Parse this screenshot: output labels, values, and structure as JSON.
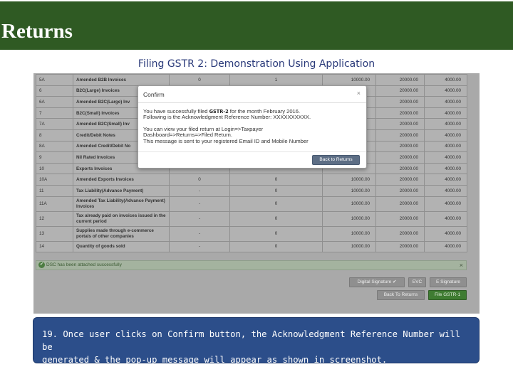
{
  "header": {
    "title": "Returns"
  },
  "subtitle": "Filing GSTR 2: Demonstration Using Application",
  "table": {
    "rows": [
      [
        "5A",
        "Amended B2B Invoices",
        "0",
        "1",
        "10000.00",
        "20000.00",
        "4000.00"
      ],
      [
        "6",
        "B2C(Large) Invoices",
        "",
        "",
        "",
        "20000.00",
        "4000.00"
      ],
      [
        "6A",
        "Amended B2C(Large) Inv",
        "",
        "",
        "",
        "20000.00",
        "4000.00"
      ],
      [
        "7",
        "B2C(Small) Invoices",
        "",
        "",
        "",
        "20000.00",
        "4000.00"
      ],
      [
        "7A",
        "Amended B2C(Small) Inv",
        "",
        "",
        "",
        "20000.00",
        "4000.00"
      ],
      [
        "8",
        "Credit/Debit Notes",
        "",
        "",
        "",
        "20000.00",
        "4000.00"
      ],
      [
        "8A",
        "Amended Credit/Debit No",
        "",
        "",
        "",
        "20000.00",
        "4000.00"
      ],
      [
        "9",
        "Nil Rated Invoices",
        "",
        "",
        "",
        "20000.00",
        "4000.00"
      ],
      [
        "10",
        "Exports Invoices",
        "",
        "",
        "",
        "20000.00",
        "4000.00"
      ],
      [
        "10A",
        "Amended Exports Invoices",
        "0",
        "0",
        "10000.00",
        "20000.00",
        "4000.00"
      ],
      [
        "11",
        "Tax Liability(Advance Payment)",
        "-",
        "0",
        "10000.00",
        "20000.00",
        "4000.00"
      ],
      [
        "11A",
        "Amended Tax Liability(Advance Payment) Invoices",
        "-",
        "0",
        "10000.00",
        "20000.00",
        "4000.00"
      ],
      [
        "12",
        "Tax already paid on invoices issued in the current period",
        "-",
        "0",
        "10000.00",
        "20000.00",
        "4000.00"
      ],
      [
        "13",
        "Supplies made through e-commerce portals of other companies",
        "-",
        "0",
        "10000.00",
        "20000.00",
        "4000.00"
      ],
      [
        "14",
        "Quantity of goods sold",
        "-",
        "0",
        "10000.00",
        "20000.00",
        "4000.00"
      ]
    ]
  },
  "status": {
    "message": "DSC has been attached successfully",
    "close": "×"
  },
  "actions": {
    "digital_signature": "Digital Signature ✔",
    "evc": "EVC",
    "e_signature": "E Signature",
    "back_to_returns": "Back To Returns",
    "file_gstr1": "File GSTR-1"
  },
  "modal": {
    "title": "Confirm",
    "close": "×",
    "line1_pre": "You have successfully filed ",
    "line1_tag": "GSTR-2",
    "line1_post": " for the month February 2016.",
    "line2": "Following is the Acknowledgment Reference Number: XXXXXXXXXX.",
    "line3": "You can view your filed return at Login=>Taxpayer",
    "line4": "Dashboard=>Returns=>Filed Return.",
    "line5": "This message is sent to your registered Email ID and Mobile Number",
    "button": "Back to Returns"
  },
  "caption": {
    "line1": "19. Once user clicks on Confirm button, the Acknowledgment Reference Number will be",
    "line2": "generated & the pop-up message will appear as shown in screenshot."
  }
}
